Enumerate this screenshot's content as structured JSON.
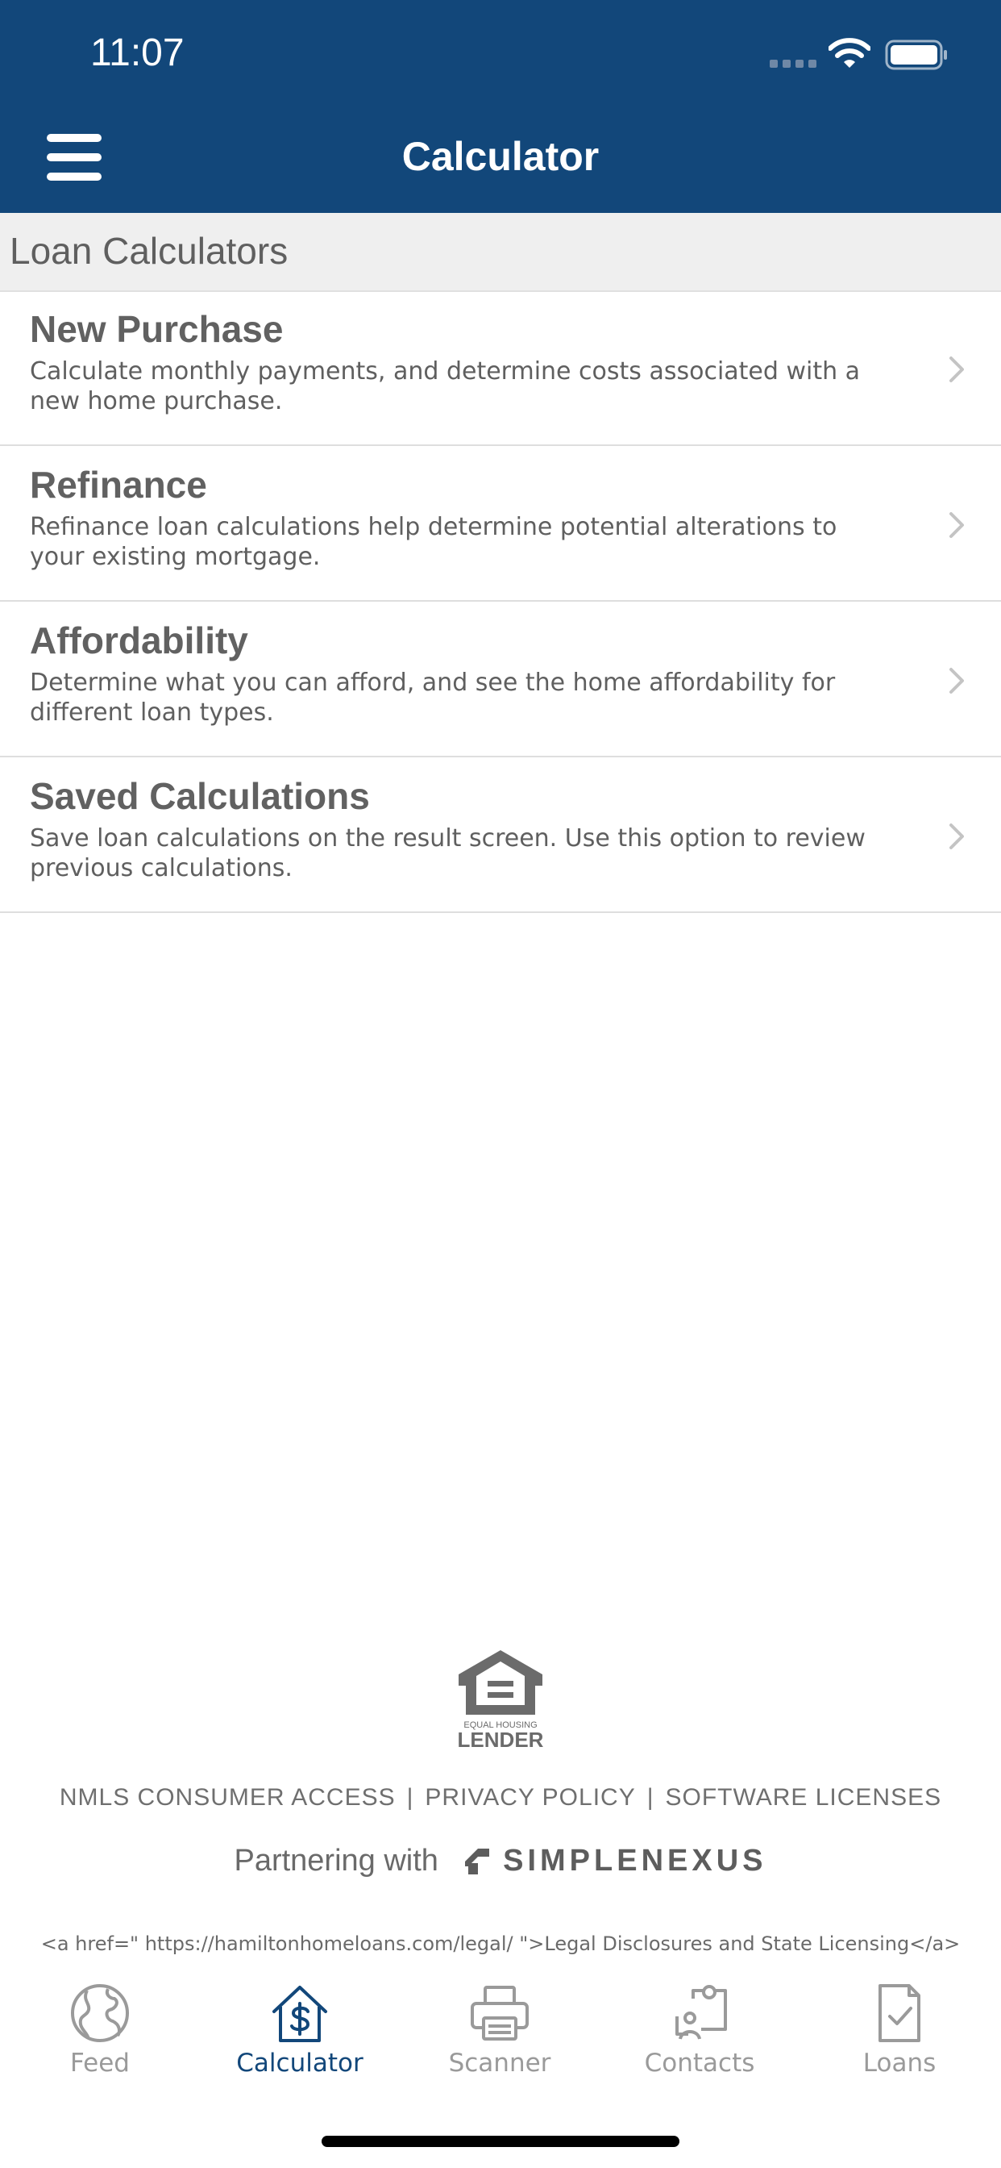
{
  "status_bar": {
    "time": "11:07"
  },
  "header": {
    "title": "Calculator"
  },
  "section": {
    "title": "Loan Calculators"
  },
  "calculators": [
    {
      "title": "New Purchase",
      "description": "Calculate monthly payments, and determine costs associated with a new home purchase."
    },
    {
      "title": "Refinance",
      "description": "Refinance loan calculations help determine potential alterations to your existing mortgage."
    },
    {
      "title": "Affordability",
      "description": "Determine what you can afford, and see the home affordability for different loan types."
    },
    {
      "title": "Saved Calculations",
      "description": "Save loan calculations on the result screen. Use this option to review previous calculations."
    }
  ],
  "footer": {
    "logo_text": [
      "EQUAL HOUSING",
      "LENDER"
    ],
    "links": [
      "NMLS CONSUMER ACCESS",
      "PRIVACY POLICY",
      "SOFTWARE LICENSES"
    ],
    "separator": "|",
    "partner_label": "Partnering with",
    "partner_name": "SIMPLENEXUS",
    "legal_text": "<a href=\" https://hamiltonhomeloans.com/legal/ \">Legal Disclosures and State Licensing</a>"
  },
  "tabs": [
    {
      "label": "Feed",
      "icon": "globe-icon",
      "active": false
    },
    {
      "label": "Calculator",
      "icon": "house-dollar-icon",
      "active": true
    },
    {
      "label": "Scanner",
      "icon": "printer-icon",
      "active": false
    },
    {
      "label": "Contacts",
      "icon": "contacts-icon",
      "active": false
    },
    {
      "label": "Loans",
      "icon": "document-check-icon",
      "active": false
    }
  ],
  "colors": {
    "header_background": "#12477a",
    "active_tab": "#12477a",
    "inactive_tab": "#9a9a9a",
    "section_background": "#efefef",
    "text_gray": "#5f5f5f"
  }
}
